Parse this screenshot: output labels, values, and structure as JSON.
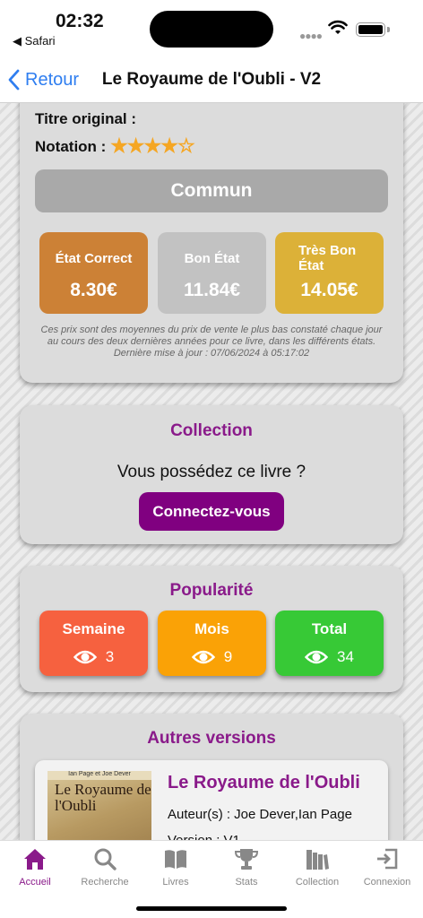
{
  "status": {
    "time": "02:32",
    "back_app": "◀ Safari"
  },
  "nav": {
    "back_label": "Retour",
    "title": "Le Royaume de l'Oubli - V2"
  },
  "details": {
    "original_title_label": "Titre original :",
    "rating_label": "Notation :",
    "rating_value": 4,
    "rating_max": 5,
    "stars_text": "★★★★☆",
    "rarity": "Commun",
    "prices": [
      {
        "label": "État Correct",
        "value": "8.30€",
        "color": "#cc8136"
      },
      {
        "label": "Bon État",
        "value": "11.84€",
        "color": "#c2c2c2"
      },
      {
        "label": "Très Bon État",
        "value": "14.05€",
        "color": "#dcb138"
      }
    ],
    "note": "Ces prix sont des moyennes du prix de vente le plus bas constaté chaque jour au cours des deux dernières années pour ce livre, dans les différents états.",
    "last_update": "Dernière mise à jour : 07/06/2024 à 05:17:02"
  },
  "collection": {
    "title": "Collection",
    "question": "Vous possédez ce livre ?",
    "button": "Connectez-vous"
  },
  "popularity": {
    "title": "Popularité",
    "items": [
      {
        "label": "Semaine",
        "count": "3",
        "color": "#f6613f"
      },
      {
        "label": "Mois",
        "count": "9",
        "color": "#faa206"
      },
      {
        "label": "Total",
        "count": "34",
        "color": "#37c936"
      }
    ]
  },
  "versions": {
    "title": "Autres versions",
    "items": [
      {
        "title": "Le Royaume de l'Oubli",
        "authors": "Auteur(s) : Joe Dever,Ian Page",
        "version": "Version : V1",
        "cover_authors": "Ian Page et Joe Dever",
        "cover_title": "Le Royaume de l'Oubli"
      }
    ]
  },
  "tabs": [
    {
      "label": "Accueil",
      "icon": "home-icon",
      "active": true
    },
    {
      "label": "Recherche",
      "icon": "search-icon",
      "active": false
    },
    {
      "label": "Livres",
      "icon": "book-icon",
      "active": false
    },
    {
      "label": "Stats",
      "icon": "trophy-icon",
      "active": false
    },
    {
      "label": "Collection",
      "icon": "books-icon",
      "active": false
    },
    {
      "label": "Connexion",
      "icon": "login-icon",
      "active": false
    }
  ],
  "colors": {
    "accent": "#800080",
    "link": "#2f7ef0",
    "star": "#f5a623"
  }
}
